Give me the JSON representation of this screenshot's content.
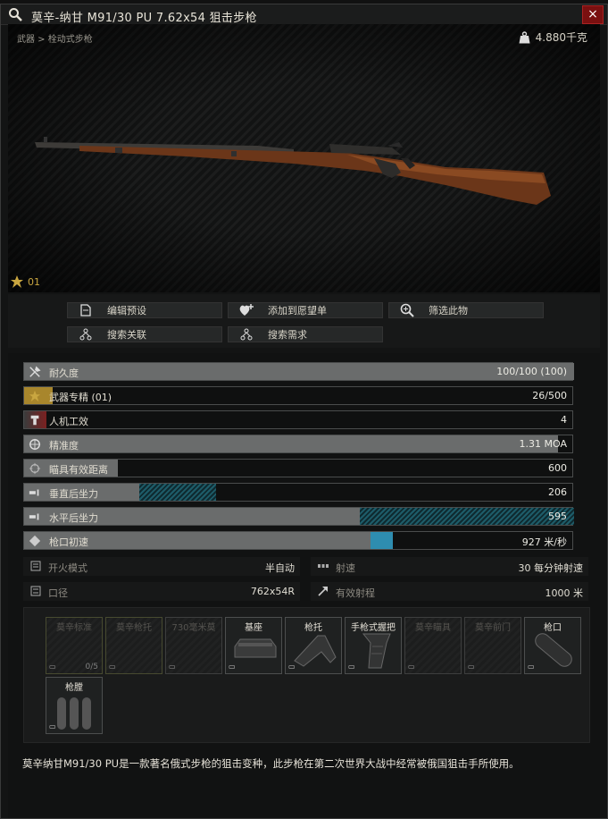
{
  "window": {
    "title": "莫辛-纳甘 M91/30 PU 7.62x54 狙击步枪",
    "close_label": "×"
  },
  "viewer": {
    "breadcrumb": "武器 > 栓动式步枪",
    "weight": "4.880千克",
    "mastery_level": "01"
  },
  "actions": {
    "edit_preset": "编辑预设",
    "add_wishlist": "添加到愿望单",
    "filter_item": "筛选此物",
    "search_links": "搜索关联",
    "search_requirements": "搜索需求"
  },
  "stats": [
    {
      "label": "耐久度",
      "value": "100/100 (100)",
      "icon": "wrench-icon",
      "fill": 1.0
    },
    {
      "label": "武器专精 (01)",
      "value": "26/500",
      "icon": "mastery-icon",
      "fill": 0.052
    },
    {
      "label": "人机工效",
      "value": "4",
      "icon": "ergonomics-icon",
      "fill": 0.04
    },
    {
      "label": "精准度",
      "value": "1.31 MOA",
      "icon": "crosshair-icon",
      "fill": 0.97
    },
    {
      "label": "瞄具有效距离",
      "value": "600",
      "icon": "sight-icon",
      "fill": 0.17
    },
    {
      "label": "垂直后坐力",
      "value": "206",
      "icon": "vertical-recoil-icon",
      "fill": 0.21,
      "fill_extra": 0.14
    },
    {
      "label": "水平后坐力",
      "value": "595",
      "icon": "horizontal-recoil-icon",
      "fill": 0.61,
      "fill_extra": 0.39
    },
    {
      "label": "枪口初速",
      "value": "927 米/秒",
      "icon": "muzzle-velocity-icon",
      "fill": 0.63,
      "fill_extra": 0.04
    }
  ],
  "info": {
    "fire_mode_label": "开火模式",
    "fire_mode_value": "半自动",
    "fire_rate_label": "射速",
    "fire_rate_value": "30 每分钟射速",
    "caliber_label": "口径",
    "caliber_value": "762x54R",
    "range_label": "有效射程",
    "range_value": "1000 米"
  },
  "mods": [
    {
      "label": "莫辛标准",
      "dim": true,
      "count": "0/5"
    },
    {
      "label": "莫辛枪托",
      "dim": true
    },
    {
      "label": "730毫米莫",
      "dim": true
    },
    {
      "label": "基座",
      "dim": false,
      "icon": "mount-icon"
    },
    {
      "label": "枪托",
      "dim": false,
      "icon": "stock-icon"
    },
    {
      "label": "手枪式握把",
      "dim": false,
      "icon": "pistol-grip-icon"
    },
    {
      "label": "莫辛瞄具",
      "dim": true
    },
    {
      "label": "莫辛前门",
      "dim": true
    },
    {
      "label": "枪口",
      "dim": false,
      "icon": "muzzle-icon"
    },
    {
      "label": "枪膛",
      "dim": false,
      "icon": "chamber-icon"
    }
  ],
  "description": "莫辛纳甘M91/30 PU是一款著名俄式步枪的狙击变种，此步枪在第二次世界大战中经常被俄国狙击手所使用。",
  "colors": {
    "accent_gold": "#c9a640",
    "recoil_blue": "#1d5c69",
    "velocity_blue": "#2e8db0",
    "close_red": "#7a1010"
  }
}
